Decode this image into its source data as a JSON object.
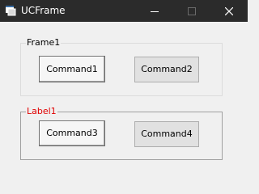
{
  "window": {
    "title": "UCFrame",
    "controls": [
      "minimize-icon",
      "maximize-icon",
      "close-icon"
    ]
  },
  "frame1": {
    "caption": "Frame1",
    "buttons": [
      {
        "label": "Command1",
        "focused": true
      },
      {
        "label": "Command2",
        "focused": false
      }
    ]
  },
  "frame2": {
    "caption": "Label1",
    "caption_color": "#e00000",
    "buttons": [
      {
        "label": "Command3",
        "focused": true
      },
      {
        "label": "Command4",
        "focused": false
      }
    ]
  },
  "colors": {
    "titlebar": "#2b2b2b",
    "window_bg": "#f0f0f0"
  }
}
